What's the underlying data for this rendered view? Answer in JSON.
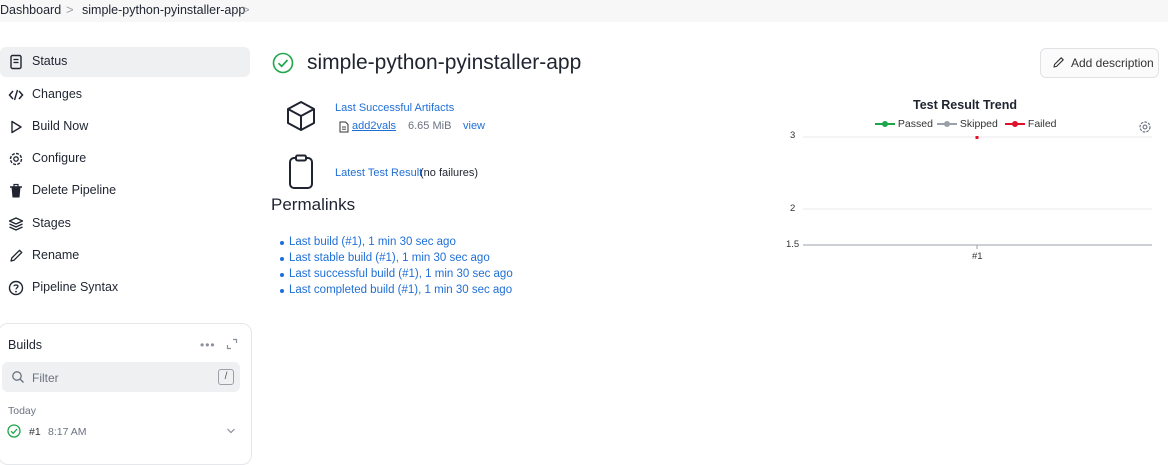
{
  "breadcrumb": {
    "items": [
      "Dashboard",
      "simple-python-pyinstaller-app"
    ],
    "separator": ">"
  },
  "sidebar": {
    "items": [
      {
        "label": "Status",
        "icon": "document-icon",
        "active": true
      },
      {
        "label": "Changes",
        "icon": "code-icon"
      },
      {
        "label": "Build Now",
        "icon": "play-icon"
      },
      {
        "label": "Configure",
        "icon": "gear-icon"
      },
      {
        "label": "Delete Pipeline",
        "icon": "trash-icon"
      },
      {
        "label": "Stages",
        "icon": "layers-icon"
      },
      {
        "label": "Rename",
        "icon": "pencil-icon"
      },
      {
        "label": "Pipeline Syntax",
        "icon": "help-icon"
      }
    ]
  },
  "builds": {
    "title": "Builds",
    "filter_placeholder": "Filter",
    "filter_shortcut": "/",
    "group_label": "Today",
    "entries": [
      {
        "number": "#1",
        "time": "8:17 AM",
        "status": "success"
      }
    ]
  },
  "main": {
    "title": "simple-python-pyinstaller-app",
    "add_description": "Add description",
    "artifacts": {
      "heading": "Last Successful Artifacts",
      "file": "add2vals",
      "size": "6.65 MiB",
      "view": "view"
    },
    "test_result": {
      "link": "Latest Test Result",
      "note": "(no failures)"
    },
    "permalinks_title": "Permalinks",
    "permalinks": [
      "Last build (#1), 1 min 30 sec ago",
      "Last stable build (#1), 1 min 30 sec ago",
      "Last successful build (#1), 1 min 30 sec ago",
      "Last completed build (#1), 1 min 30 sec ago"
    ]
  },
  "colors": {
    "link": "#1f6fd6",
    "success": "#1ea64a",
    "passed": "#1ea64a",
    "skipped": "#9aa0a8",
    "failed": "#e0102a"
  },
  "chart_data": {
    "type": "line",
    "title": "Test Result Trend",
    "legend_placement": "top",
    "series": [
      {
        "name": "Passed",
        "color": "#1ea64a",
        "values": [
          3
        ]
      },
      {
        "name": "Skipped",
        "color": "#9aa0a8",
        "values": [
          0
        ]
      },
      {
        "name": "Failed",
        "color": "#e0102a",
        "values": [
          0
        ]
      }
    ],
    "x": [
      "#1"
    ],
    "y_ticks": [
      "3",
      "2",
      "1.5"
    ],
    "ylim": [
      1.5,
      3
    ],
    "grid": true
  }
}
